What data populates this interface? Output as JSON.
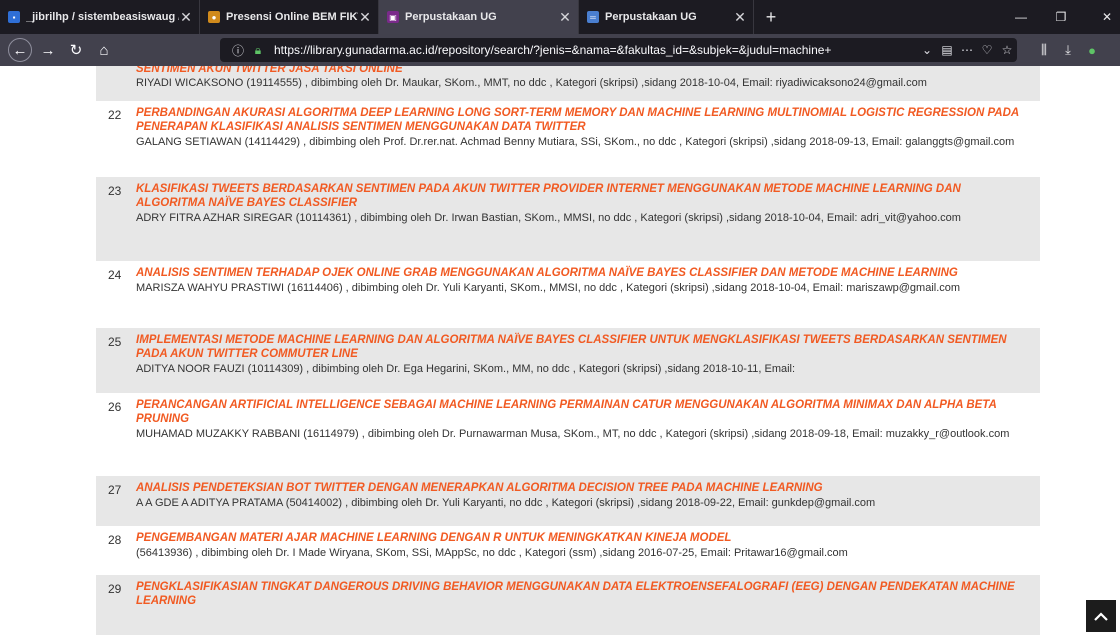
{
  "browser": {
    "tabs": [
      {
        "title": "_jibrilhp / sistembeasiswaug / ",
        "fav_color": "#2f6fd6",
        "fav_glyph": "▪",
        "active": false
      },
      {
        "title": "Presensi Online BEM FIKTI",
        "fav_color": "#d08a1c",
        "fav_glyph": "●",
        "active": false
      },
      {
        "title": "Perpustakaan UG",
        "fav_color": "#7a2a8a",
        "fav_glyph": "▣",
        "active": true
      },
      {
        "title": "Perpustakaan UG",
        "fav_color": "#4a7fd0",
        "fav_glyph": "═",
        "active": false
      }
    ],
    "url": "https://library.gunadarma.ac.id/repository/search/?jenis=&nama=&fakultas_id=&subjek=&judul=machine+"
  },
  "results": [
    {
      "num": "",
      "title": "SENTIMEN AKUN TWITTER JASA TAKSI ONLINE",
      "info": "RIYADI WICAKSONO (19114555) ,   dibimbing oleh Dr. Maukar, SKom., MMT, no ddc , Kategori (skripsi) ,sidang 2018-10-04, Email: riyadiwicaksono24@gmail.com"
    },
    {
      "num": "22",
      "title": "PERBANDINGAN AKURASI ALGORITMA DEEP LEARNING LONG SORT-TERM MEMORY DAN MACHINE LEARNING MULTINOMIAL LOGISTIC REGRESSION PADA PENERAPAN KLASIFIKASI ANALISIS SENTIMEN MENGGUNAKAN DATA TWITTER",
      "info": "GALANG SETIAWAN (14114429) ,   dibimbing oleh Prof. Dr.rer.nat. Achmad Benny Mutiara, SSi, SKom., no ddc , Kategori (skripsi) ,sidang 2018-09-13, Email: galanggts@gmail.com"
    },
    {
      "num": "23",
      "title": "KLASIFIKASI TWEETS BERDASARKAN SENTIMEN PADA AKUN TWITTER PROVIDER INTERNET MENGGUNAKAN METODE MACHINE LEARNING DAN ALGORITMA NAÏVE BAYES CLASSIFIER",
      "info": "ADRY FITRA AZHAR SIREGAR (10114361) ,   dibimbing oleh Dr. Irwan Bastian, SKom., MMSI, no ddc , Kategori (skripsi) ,sidang 2018-10-04, Email: adri_vit@yahoo.com"
    },
    {
      "num": "24",
      "title": "ANALISIS SENTIMEN TERHADAP OJEK ONLINE GRAB MENGGUNAKAN ALGORITMA NAÏVE BAYES CLASSIFIER DAN METODE MACHINE LEARNING",
      "info": "MARISZA WAHYU PRASTIWI (16114406) ,   dibimbing oleh Dr. Yuli Karyanti, SKom., MMSI, no ddc , Kategori (skripsi) ,sidang 2018-10-04, Email: mariszawp@gmail.com"
    },
    {
      "num": "25",
      "title": "IMPLEMENTASI METODE MACHINE LEARNING DAN ALGORITMA NAÏVE BAYES CLASSIFIER UNTUK MENGKLASIFIKASI TWEETS BERDASARKAN SENTIMEN PADA AKUN TWITTER COMMUTER LINE",
      "info": "ADITYA NOOR FAUZI (10114309) ,   dibimbing oleh Dr. Ega Hegarini, SKom., MM, no ddc , Kategori (skripsi) ,sidang 2018-10-11, Email:"
    },
    {
      "num": "26",
      "title": "PERANCANGAN ARTIFICIAL INTELLIGENCE SEBAGAI MACHINE LEARNING PERMAINAN CATUR MENGGUNAKAN ALGORITMA MINIMAX DAN ALPHA BETA PRUNING",
      "info": "MUHAMAD MUZAKKY RABBANI (16114979) ,   dibimbing oleh Dr. Purnawarman Musa, SKom., MT, no ddc , Kategori (skripsi) ,sidang 2018-09-18, Email: muzakky_r@outlook.com"
    },
    {
      "num": "27",
      "title": "ANALISIS PENDETEKSIAN BOT TWITTER DENGAN MENERAPKAN ALGORITMA DECISION TREE PADA MACHINE LEARNING",
      "info": "A A GDE A ADITYA PRATAMA (50414002) ,   dibimbing oleh Dr. Yuli Karyanti, no ddc , Kategori (skripsi) ,sidang 2018-09-22, Email: gunkdep@gmail.com"
    },
    {
      "num": "28",
      "title": "PENGEMBANGAN MATERI AJAR MACHINE LEARNING DENGAN R UNTUK MENINGKATKAN KINEJA MODEL",
      "info": "(56413936) ,   dibimbing oleh Dr. I Made Wiryana, SKom, SSi, MAppSc, no ddc , Kategori (ssm) ,sidang 2016-07-25, Email: Pritawar16@gmail.com"
    },
    {
      "num": "29",
      "title": "PENGKLASIFIKASIAN TINGKAT DANGEROUS DRIVING BEHAVIOR MENGGUNAKAN DATA ELEKTROENSEFALOGRAFI (EEG) DENGAN PENDEKATAN MACHINE LEARNING",
      "info": ""
    }
  ]
}
